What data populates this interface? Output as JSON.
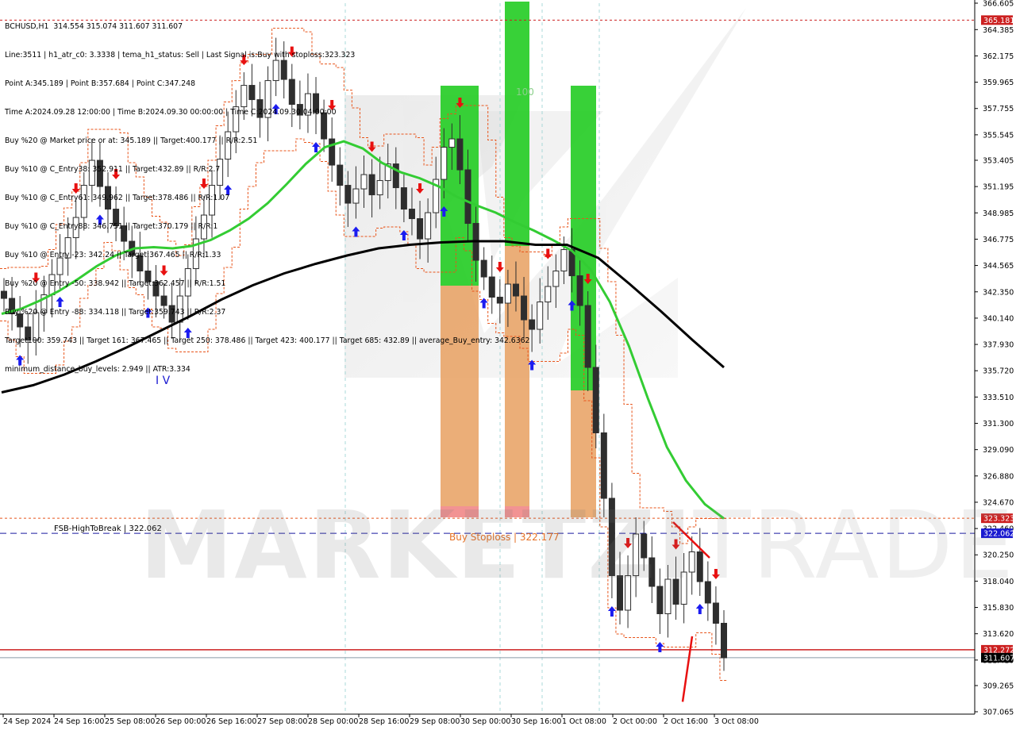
{
  "header": {
    "lines": [
      "BCHUSD,H1  314.554 315.074 311.607 311.607",
      "Line:3511 | h1_atr_c0: 3.3338 | tema_h1_status: Sell | Last Signal is:Buy with stoploss:323.323",
      "Point A:345.189 | Point B:357.684 | Point C:347.248",
      "Time A:2024.09.28 12:00:00 | Time B:2024.09.30 00:00:00 | Time C:2024.09.30 04:00:00",
      "Buy %20 @ Market price or at: 345.189 || Target:400.177 || R/R:2.51",
      "Buy %10 @ C_Entry38: 352.911 || Target:432.89 || R/R:2.7",
      "Buy %10 @ C_Entry61: 349.962 || Target:378.486 || R/R:1.07",
      "Buy %10 @ C_Entry88: 346.751 || Target:370.179 || R/R:1",
      "Buy %10 @ Entry -23: 342.24 || Target:367.465 || R/R:1.33",
      "Buy %20 @ Entry -50: 338.942 || Target:362.457 || R/R:1.51",
      "Buy %20 @ Entry -88: 334.118 || Target:359.743 || R/R:2.37",
      "Target100: 359.743 || Target 161: 367.465 || Target 250: 378.486 || Target 423: 400.177 || Target 685: 432.89 || average_Buy_entry: 342.6362",
      "minimum_distance_buy_levels: 2.949 || ATR:3.334"
    ]
  },
  "watermark": {
    "bold": "MARKETZI",
    "thin": "TRADE"
  },
  "annotations": {
    "fsb_label": "FSB-HighToBreak | 322.062",
    "stoploss_label": "Buy Stoploss | 322.177",
    "wave_label": "I V",
    "zone_label": "100"
  },
  "colors": {
    "background": "#ffffff",
    "bull_candle": "#2e2e2e",
    "bear_candle": "#2e2e2e",
    "ema_fast": "#33cc33",
    "ema_slow": "#000000",
    "channel": "#e8541a",
    "zone_green": "#22cc22",
    "zone_orange": "#e8a060",
    "zone_red": "#f08080",
    "stoploss_line": "#1a1aa0",
    "arrow_up": "#1c1cf0",
    "arrow_down": "#e81010",
    "price_tag_red": "#cc2020",
    "price_tag_blue": "#1a1ad0",
    "price_tag_black": "#000000"
  },
  "chart_data": {
    "type": "candlestick",
    "symbol": "BCHUSD",
    "timeframe": "H1",
    "ylim": [
      307.065,
      366.605
    ],
    "y_ticks": [
      "366.605",
      "364.385",
      "362.175",
      "359.965",
      "357.755",
      "355.545",
      "353.405",
      "351.195",
      "348.985",
      "346.775",
      "344.565",
      "342.350",
      "340.140",
      "337.930",
      "335.720",
      "333.510",
      "331.300",
      "329.090",
      "326.880",
      "324.670",
      "322.460",
      "320.250",
      "318.040",
      "315.830",
      "313.620",
      "311.410",
      "309.265",
      "307.065"
    ],
    "x_ticks": [
      "24 Sep 2024",
      "24 Sep 16:00",
      "25 Sep 08:00",
      "26 Sep 00:00",
      "26 Sep 16:00",
      "27 Sep 08:00",
      "28 Sep 00:00",
      "28 Sep 16:00",
      "29 Sep 08:00",
      "30 Sep 00:00",
      "30 Sep 16:00",
      "1 Oct 08:00",
      "2 Oct 00:00",
      "2 Oct 16:00",
      "3 Oct 08:00"
    ],
    "price_tags": [
      {
        "label": "365.181",
        "value": 365.181,
        "color": "red"
      },
      {
        "label": "323.323",
        "value": 323.323,
        "color": "red"
      },
      {
        "label": "322.062",
        "value": 322.062,
        "color": "blue"
      },
      {
        "label": "312.272",
        "value": 312.272,
        "color": "red"
      },
      {
        "label": "311.607",
        "value": 311.607,
        "color": "black"
      }
    ],
    "closes": [
      341.8,
      340.5,
      339.4,
      338.3,
      340.6,
      342.1,
      343.8,
      345.2,
      346.9,
      348.6,
      351.3,
      353.4,
      351.2,
      349.3,
      347.9,
      346.6,
      345.4,
      344.1,
      343.2,
      342.0,
      341.2,
      339.8,
      342.0,
      344.3,
      346.8,
      348.8,
      351.3,
      353.5,
      355.8,
      357.9,
      359.7,
      358.5,
      357.0,
      360.1,
      361.8,
      360.2,
      358.1,
      357.2,
      359.0,
      357.4,
      355.2,
      353.0,
      351.3,
      349.8,
      351.0,
      352.2,
      350.5,
      351.7,
      353.1,
      351.1,
      349.3,
      348.5,
      346.8,
      349.0,
      351.8,
      354.5,
      355.2,
      352.6,
      348.1,
      345.0,
      343.6,
      341.9,
      341.4,
      343.0,
      342.0,
      340.0,
      339.2,
      341.5,
      342.8,
      344.1,
      345.9,
      343.7,
      341.2,
      336.0,
      330.5,
      325.0,
      318.5,
      315.6,
      318.5,
      322.0,
      320.0,
      317.6,
      315.3,
      318.2,
      316.1,
      318.8,
      320.5,
      318.0,
      316.2,
      314.5,
      311.6
    ],
    "ema_fast": [
      340.5,
      340.9,
      341.6,
      342.4,
      343.4,
      344.5,
      345.4,
      346.0,
      346.1,
      346.0,
      346.2,
      346.7,
      347.5,
      348.5,
      349.8,
      351.4,
      353.1,
      354.5,
      355.0,
      354.4,
      353.2,
      352.4,
      351.9,
      351.2,
      350.3,
      349.6,
      349.0,
      348.2,
      347.5,
      346.7,
      345.8,
      344.2,
      341.5,
      337.8,
      333.4,
      329.3,
      326.5,
      324.5,
      323.3
    ],
    "ema_slow": [
      333.9,
      334.5,
      335.4,
      336.5,
      337.7,
      339.0,
      340.3,
      341.7,
      342.9,
      343.9,
      344.7,
      345.4,
      346.0,
      346.3,
      346.5,
      346.6,
      346.6,
      346.3,
      346.3,
      345.2,
      343.0,
      340.7,
      338.3,
      336.0
    ],
    "signals_up": 17,
    "signals_down": 17
  }
}
